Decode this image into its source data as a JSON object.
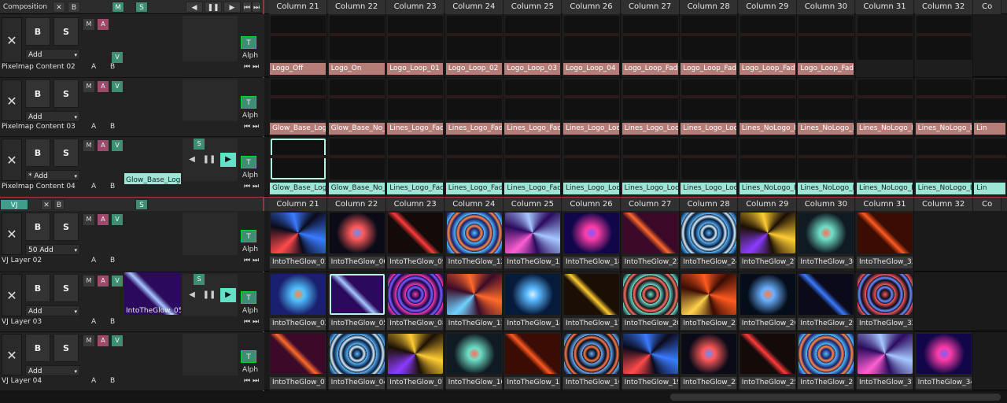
{
  "composition_bar": {
    "title": "Composition",
    "close": "✕",
    "b": "B",
    "m": "M",
    "s": "S",
    "transport": {
      "prev": "◀",
      "pause": "❚❚",
      "next": "▶",
      "first": "⏮",
      "last": "⏭"
    },
    "columns": [
      "Column 21",
      "Column 22",
      "Column 23",
      "Column 24",
      "Column 25",
      "Column 26",
      "Column 27",
      "Column 28",
      "Column 29",
      "Column 30",
      "Column 31",
      "Column 32",
      "Co"
    ]
  },
  "deck2_bar": {
    "title": "VJ CLIPS",
    "close": "✕",
    "b": "B",
    "s": "S",
    "columns": [
      "Column 21",
      "Column 22",
      "Column 23",
      "Column 24",
      "Column 25",
      "Column 26",
      "Column 27",
      "Column 28",
      "Column 29",
      "Column 30",
      "Column 31",
      "Column 32",
      "Co"
    ]
  },
  "common": {
    "x": "✕",
    "b": "B",
    "s": "S",
    "m": "M",
    "a": "A",
    "v": "V",
    "t": "T",
    "alph": "Alph",
    "ab_a": "A",
    "ab_b": "B",
    "caret": "▾",
    "nav_first": "⏮",
    "nav_last": "⏭"
  },
  "layers": [
    {
      "name": "Pixelmap Content 02",
      "add": "Add",
      "labels": [
        "Logo_Off",
        "Logo_On",
        "Logo_Loop_01",
        "Logo_Loop_02",
        "Logo_Loop_03",
        "Logo_Loop_04",
        "Logo_Loop_Fade_01",
        "Logo_Loop_Fade_02",
        "Logo_Loop_Fade_03",
        "Logo_Loop_Fade_04",
        "",
        ""
      ]
    },
    {
      "name": "Pixelmap Content 03",
      "add": "Add",
      "labels": [
        "Glow_Base_Logo",
        "Glow_Base_No_Logo",
        "Lines_Logo_Fade_...",
        "Lines_Logo_Fade_...",
        "Lines_Logo_Fade_...",
        "Lines_Logo_Loop01",
        "Lines_Logo_Loop02",
        "Lines_Logo_Loop03",
        "Lines_NoLogo_Fa...",
        "Lines_NoLogo_Fa...",
        "Lines_NoLogo_Fa...",
        "Lines_NoLogo_Lo...",
        "Lin"
      ]
    },
    {
      "name": "Pixelmap Content 04",
      "add": "* Add",
      "clip": "Glow_Base_Logo",
      "labels": [
        "Glow_Base_Logo",
        "Glow_Base_No_Lo",
        "Lines_Logo_Fade",
        "Lines_Logo_Fade",
        "Lines_Logo_Fade",
        "Lines_Logo_Loop0",
        "Lines_Logo_Loop0",
        "Lines_Logo_Loop0",
        "Lines_NoLogo_Fa",
        "Lines_NoLogo_Fa",
        "Lines_NoLogo_Fa",
        "Lines_NoLogo_Lo",
        "Lin"
      ]
    },
    {
      "name": "VJ Layer 02",
      "add": "50 Add",
      "labels": [
        "IntoTheGlow_03",
        "IntoTheGlow_06",
        "IntoTheGlow_09",
        "IntoTheGlow_12",
        "IntoTheGlow_15",
        "IntoTheGlow_18",
        "IntoTheGlow_21",
        "IntoTheGlow_24",
        "IntoTheGlow_27_...",
        "IntoTheGlow_30_...",
        "IntoTheGlow_33_..."
      ]
    },
    {
      "name": "VJ Layer 03",
      "add": "Add",
      "clip": "IntoTheGlow_05",
      "labels": [
        "IntoTheGlow_02",
        "IntoTheGlow_05",
        "IntoTheGlow_08",
        "IntoTheGlow_11",
        "IntoTheGlow_14",
        "IntoTheGlow_17",
        "IntoTheGlow_20",
        "IntoTheGlow_23",
        "IntoTheGlow_26",
        "IntoTheGlow_29_...",
        "IntoTheGlow_32_..."
      ]
    },
    {
      "name": "VJ Layer 04",
      "add": "Add",
      "labels": [
        "IntoTheGlow_01",
        "IntoTheGlow_04",
        "IntoTheGlow_07",
        "IntoTheGlow_10",
        "IntoTheGlow_13",
        "IntoTheGlow_16",
        "IntoTheGlow_19",
        "IntoTheGlow_22",
        "IntoTheGlow_25",
        "IntoTheGlow_28_...",
        "IntoTheGlow_31_...",
        "IntoTheGlow_34"
      ]
    }
  ],
  "colors": {
    "accent_green": "#3f8e73",
    "salmon": "#b57c78",
    "mint": "#9ee6d4",
    "pink": "#9b4a6a"
  }
}
